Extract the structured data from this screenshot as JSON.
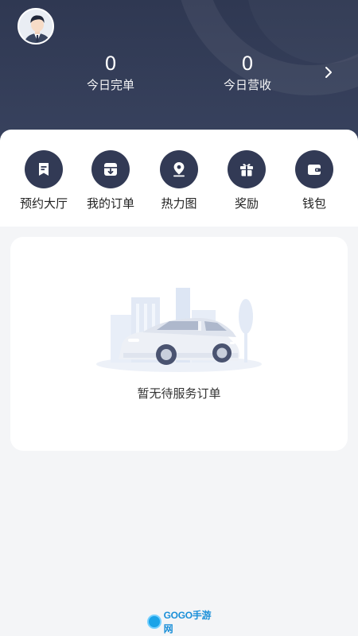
{
  "header": {
    "stats": [
      {
        "value": "0",
        "label": "今日完单"
      },
      {
        "value": "0",
        "label": "今日营收"
      }
    ],
    "detail_icon": "chevron-right-icon"
  },
  "menu": {
    "items": [
      {
        "label": "预约大厅",
        "icon": "booking-hall-icon"
      },
      {
        "label": "我的订单",
        "icon": "my-orders-icon"
      },
      {
        "label": "热力图",
        "icon": "heatmap-location-icon"
      },
      {
        "label": "奖励",
        "icon": "gift-icon"
      },
      {
        "label": "钱包",
        "icon": "wallet-icon"
      }
    ]
  },
  "orders": {
    "empty_text": "暂无待服务订单"
  },
  "watermark": {
    "text": "GOGO手游网"
  },
  "colors": {
    "header_bg": "#2f3852",
    "icon_circle": "#323a55",
    "page_bg": "#f4f5f7"
  }
}
